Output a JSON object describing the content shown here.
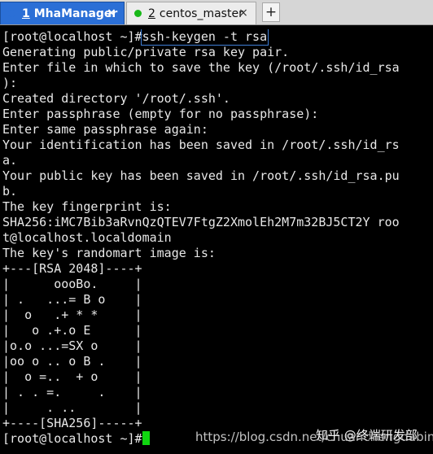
{
  "tabs": [
    {
      "number": "1",
      "label": "MhaManager",
      "status_color": "#2b6fd6",
      "active": true,
      "close_label": "×"
    },
    {
      "number": "2",
      "label": "centos_master",
      "status_color": "#18b818",
      "active": false,
      "close_label": "×"
    }
  ],
  "new_tab_label": "+",
  "terminal": {
    "prompt": "[root@localhost ~]#",
    "command": "ssh-keygen -t rsa",
    "lines": [
      "Generating public/private rsa key pair.",
      "Enter file in which to save the key (/root/.ssh/id_rsa",
      "):",
      "Created directory '/root/.ssh'.",
      "Enter passphrase (empty for no passphrase):",
      "Enter same passphrase again:",
      "Your identification has been saved in /root/.ssh/id_rs",
      "a.",
      "Your public key has been saved in /root/.ssh/id_rsa.pu",
      "b.",
      "The key fingerprint is:",
      "SHA256:iMC7Bib3aRvnQzQTEV7FtgZ2XmolEh2M7m32BJ5CT2Y roo",
      "t@localhost.localdomain",
      "The key's randomart image is:",
      "+---[RSA 2048]----+",
      "|      oooBo.     |",
      "| .   ...= B o    |",
      "|  o   .+ * *     |",
      "|   o .+.o E      |",
      "|o.o ...=SX o     |",
      "|oo o .. o B .    |",
      "|  o =..  + o     |",
      "| . . =.     .    |",
      "|     . ..        |",
      "+----[SHA256]-----+"
    ],
    "final_prompt": "[root@localhost ~]#",
    "cursor_color": "#10d610"
  },
  "watermark": {
    "url": "https://blog.csdn.net/chuanchengdabing",
    "brand": "知乎 @终端研发部"
  }
}
